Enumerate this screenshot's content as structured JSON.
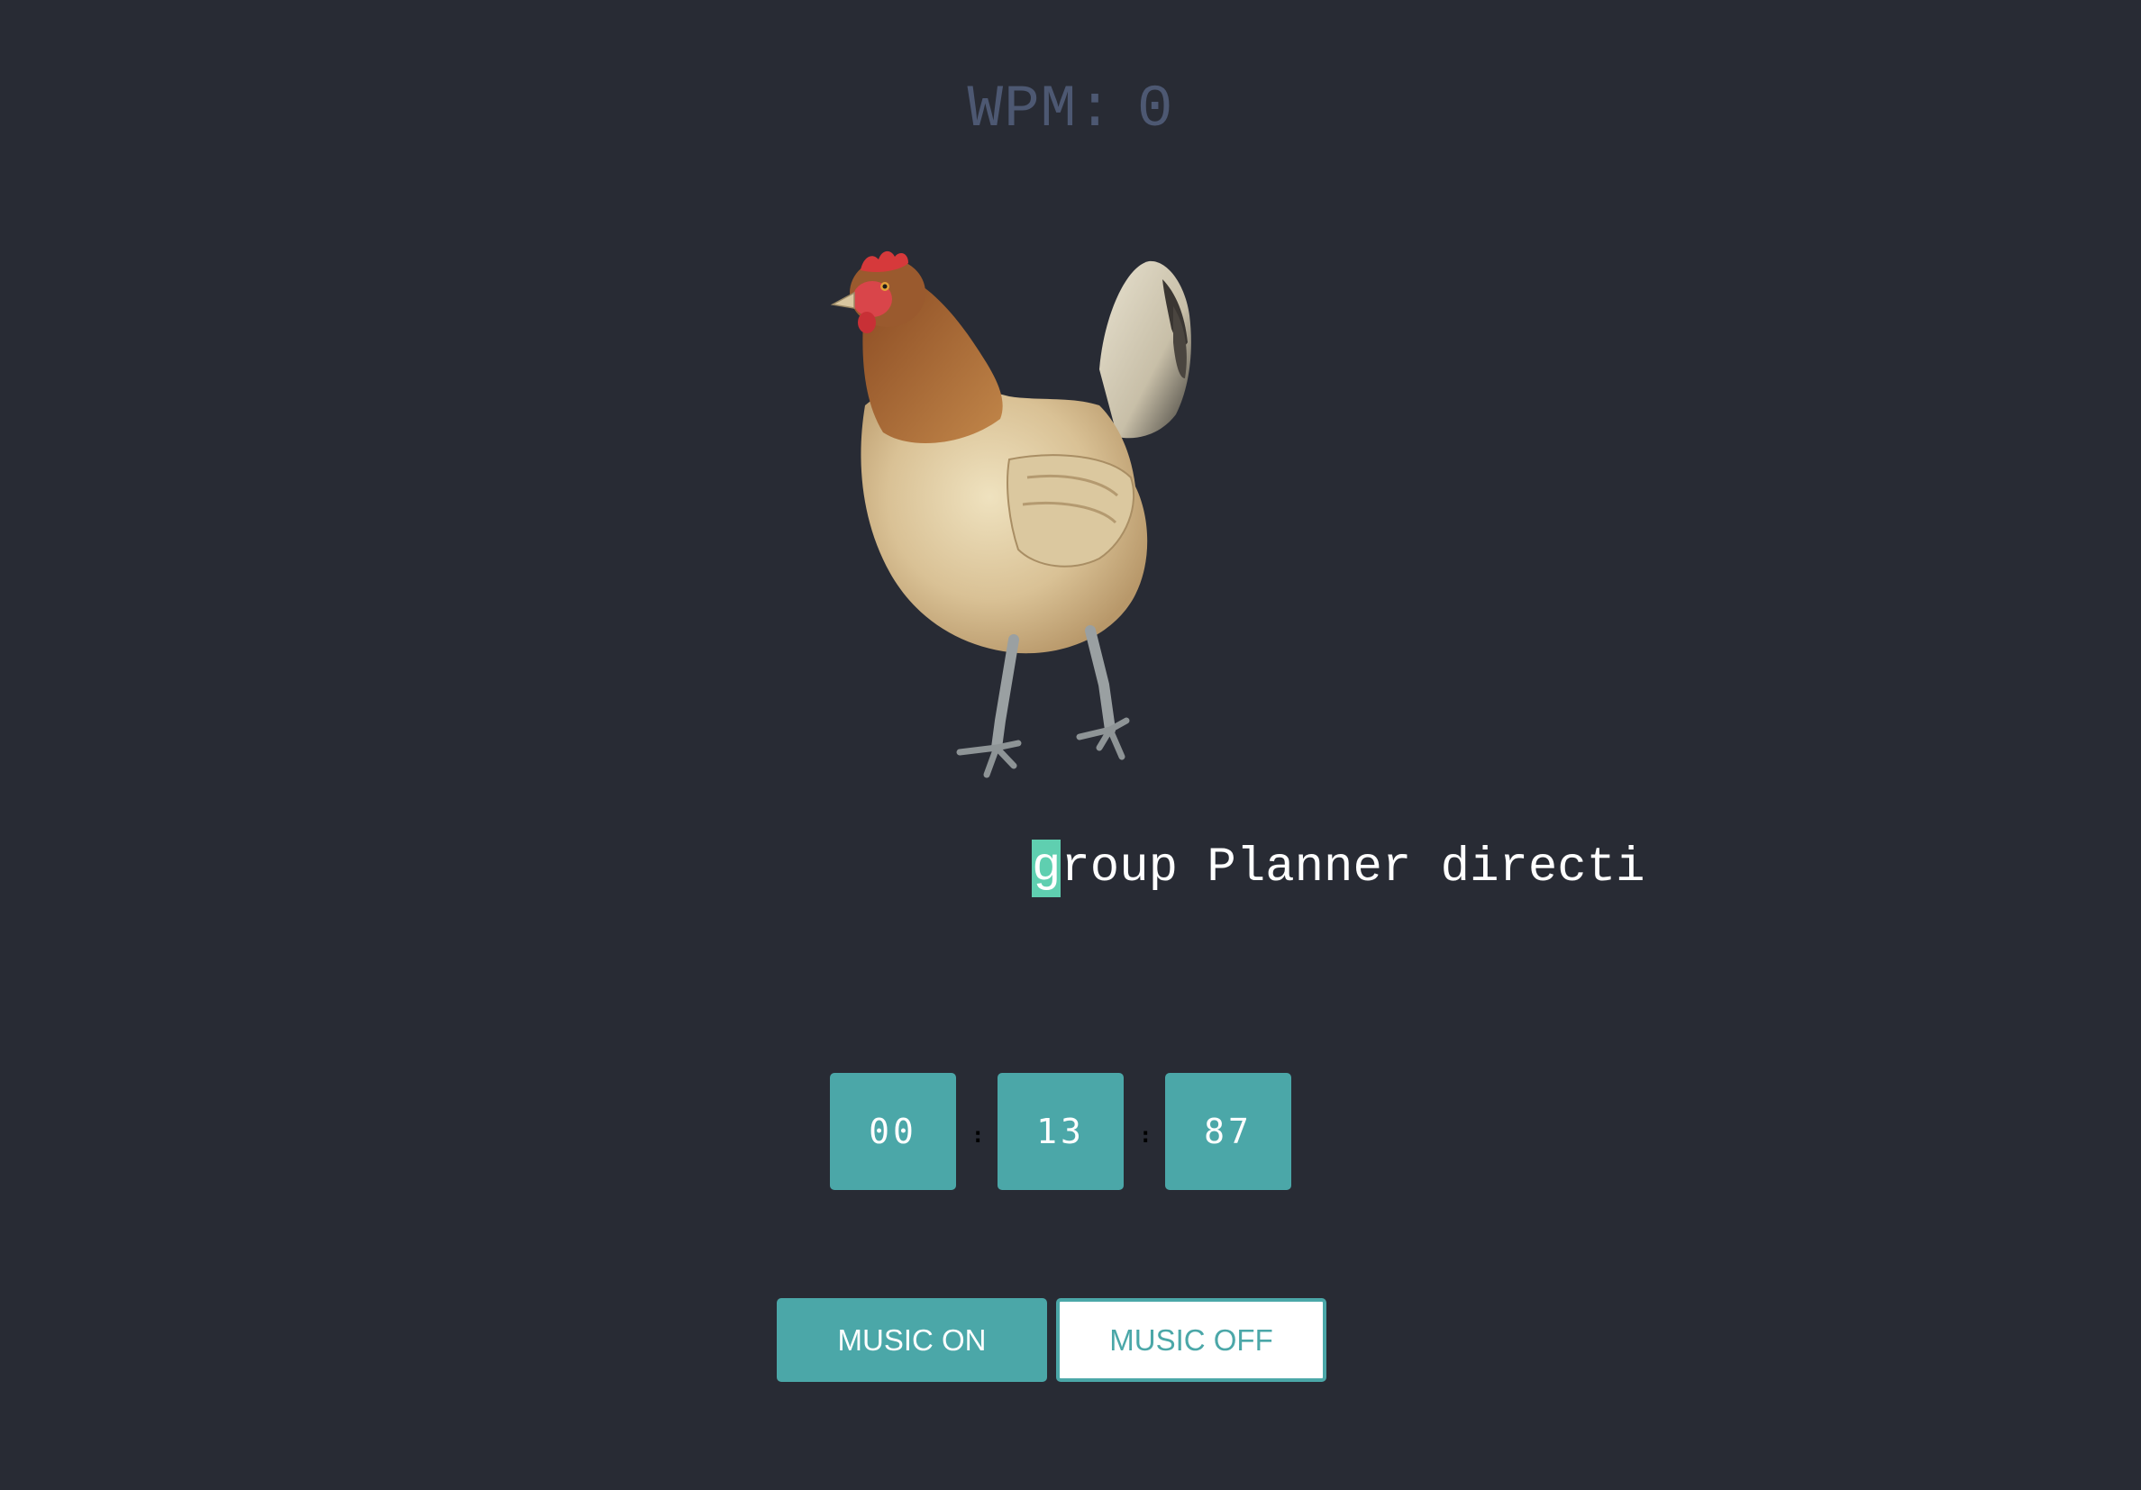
{
  "header": {
    "wpm_label": "WPM:",
    "wpm_value": "0"
  },
  "mascot": {
    "icon": "chicken-image"
  },
  "typing": {
    "current_char": "g",
    "remaining_text": "roup Planner directi"
  },
  "timer": {
    "minutes": "00",
    "seconds": "13",
    "centiseconds": "87",
    "separator": ":"
  },
  "controls": {
    "music_on_label": "MUSIC ON",
    "music_off_label": "MUSIC OFF"
  },
  "colors": {
    "background": "#282b34",
    "accent": "#4ba7a8",
    "cursor": "#5fcfb0",
    "wpm_text": "#4d5872"
  }
}
